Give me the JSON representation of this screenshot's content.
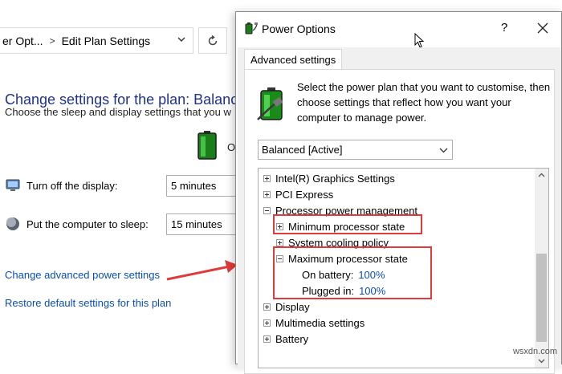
{
  "background": {
    "breadcrumb": [
      "er Opt...",
      "Edit Plan Settings"
    ],
    "title": "Change settings for the plan: Balance",
    "subtitle": "Choose the sleep and display settings that you w",
    "column_header": "O",
    "rows": [
      {
        "label": "Turn off the display:",
        "value": "5 minutes"
      },
      {
        "label": "Put the computer to sleep:",
        "value": "15 minutes"
      }
    ],
    "links": {
      "advanced": "Change advanced power settings",
      "restore": "Restore default settings for this plan"
    }
  },
  "dialog": {
    "title": "Power Options",
    "help": "?",
    "tab": "Advanced settings",
    "intro": "Select the power plan that you want to customise, then choose settings that reflect how you want your computer to manage power.",
    "plan_selected": "Balanced [Active]",
    "tree": {
      "intel": "Intel(R) Graphics Settings",
      "pci": "PCI Express",
      "processor": "Processor power management",
      "min_state": "Minimum processor state",
      "cooling": "System cooling policy",
      "max_state": "Maximum processor state",
      "on_battery_label": "On battery:",
      "on_battery_value": "100%",
      "plugged_label": "Plugged in:",
      "plugged_value": "100%",
      "display": "Display",
      "multimedia": "Multimedia settings",
      "battery": "Battery"
    }
  },
  "watermark": "wsxdn.com",
  "colors": {
    "title_blue": "#1e3287",
    "link_blue": "#0a4fb4",
    "highlight_red": "#e03a3a"
  }
}
